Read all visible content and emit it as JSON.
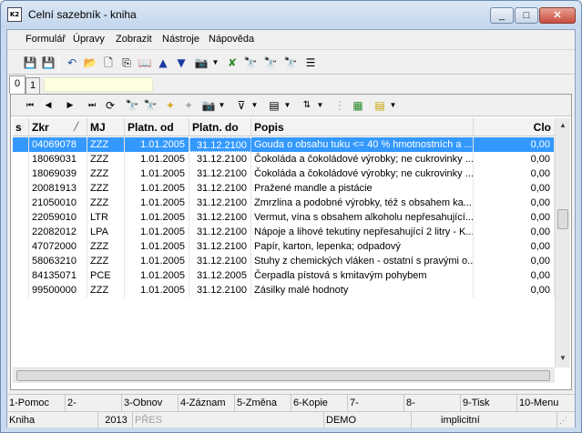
{
  "window": {
    "title": "Celní sazebník - kniha",
    "icon_label": "K2",
    "controls": {
      "minimize": "_",
      "maximize": "□",
      "close": "✕"
    }
  },
  "menu": [
    "Formulář",
    "Úpravy",
    "Zobrazit",
    "Nástroje",
    "Nápověda"
  ],
  "tabs": [
    "0",
    "1"
  ],
  "grid": {
    "columns": [
      "s",
      "Zkr",
      "MJ",
      "Platn. od",
      "Platn. do",
      "Popis",
      "Clo"
    ],
    "rows": [
      {
        "s": "",
        "zkr": "04069078",
        "mj": "ZZZ",
        "od": "1.01.2005",
        "do": "31.12.2100",
        "popis": "Gouda o obsahu tuku <= 40 % hmotnostních a ...",
        "clo": "0,00"
      },
      {
        "s": "",
        "zkr": "18069031",
        "mj": "ZZZ",
        "od": "1.01.2005",
        "do": "31.12.2100",
        "popis": "Čokoláda a čokoládové výrobky; ne cukrovinky ...",
        "clo": "0,00"
      },
      {
        "s": "",
        "zkr": "18069039",
        "mj": "ZZZ",
        "od": "1.01.2005",
        "do": "31.12.2100",
        "popis": "Čokoláda a čokoládové výrobky; ne cukrovinky ...",
        "clo": "0,00"
      },
      {
        "s": "",
        "zkr": "20081913",
        "mj": "ZZZ",
        "od": "1.01.2005",
        "do": "31.12.2100",
        "popis": "Pražené mandle a pistácie",
        "clo": "0,00"
      },
      {
        "s": "",
        "zkr": "21050010",
        "mj": "ZZZ",
        "od": "1.01.2005",
        "do": "31.12.2100",
        "popis": "Zmrzlina a podobné výrobky, též s obsahem ka...",
        "clo": "0,00"
      },
      {
        "s": "",
        "zkr": "22059010",
        "mj": "LTR",
        "od": "1.01.2005",
        "do": "31.12.2100",
        "popis": "Vermut, vína s obsahem alkoholu nepřesahující...",
        "clo": "0,00"
      },
      {
        "s": "",
        "zkr": "22082012",
        "mj": "LPA",
        "od": "1.01.2005",
        "do": "31.12.2100",
        "popis": "Nápoje a lihové tekutiny nepřesahující 2 litry - K...",
        "clo": "0,00"
      },
      {
        "s": "",
        "zkr": "47072000",
        "mj": "ZZZ",
        "od": "1.01.2005",
        "do": "31.12.2100",
        "popis": "Papír, karton, lepenka; odpadový",
        "clo": "0,00"
      },
      {
        "s": "",
        "zkr": "58063210",
        "mj": "ZZZ",
        "od": "1.01.2005",
        "do": "31.12.2100",
        "popis": "Stuhy z chemických vláken - ostatní s pravými o...",
        "clo": "0,00"
      },
      {
        "s": "",
        "zkr": "84135071",
        "mj": "PCE",
        "od": "1.01.2005",
        "do": "31.12.2005",
        "popis": "Čerpadla pístová s kmitavým pohybem",
        "clo": "0,00"
      },
      {
        "s": "",
        "zkr": "99500000",
        "mj": "ZZZ",
        "od": "1.01.2005",
        "do": "31.12.2100",
        "popis": "Zásilky malé hodnoty",
        "clo": "0,00"
      }
    ]
  },
  "fkeys": [
    "1-Pomoc",
    "2-",
    "3-Obnov",
    "4-Záznam",
    "5-Změna",
    "6-Kopie",
    "7-",
    "8-",
    "9-Tisk",
    "10-Menu"
  ],
  "status": [
    "Kniha",
    "2013",
    "PŘES",
    "",
    "DEMO",
    "implicitní"
  ]
}
